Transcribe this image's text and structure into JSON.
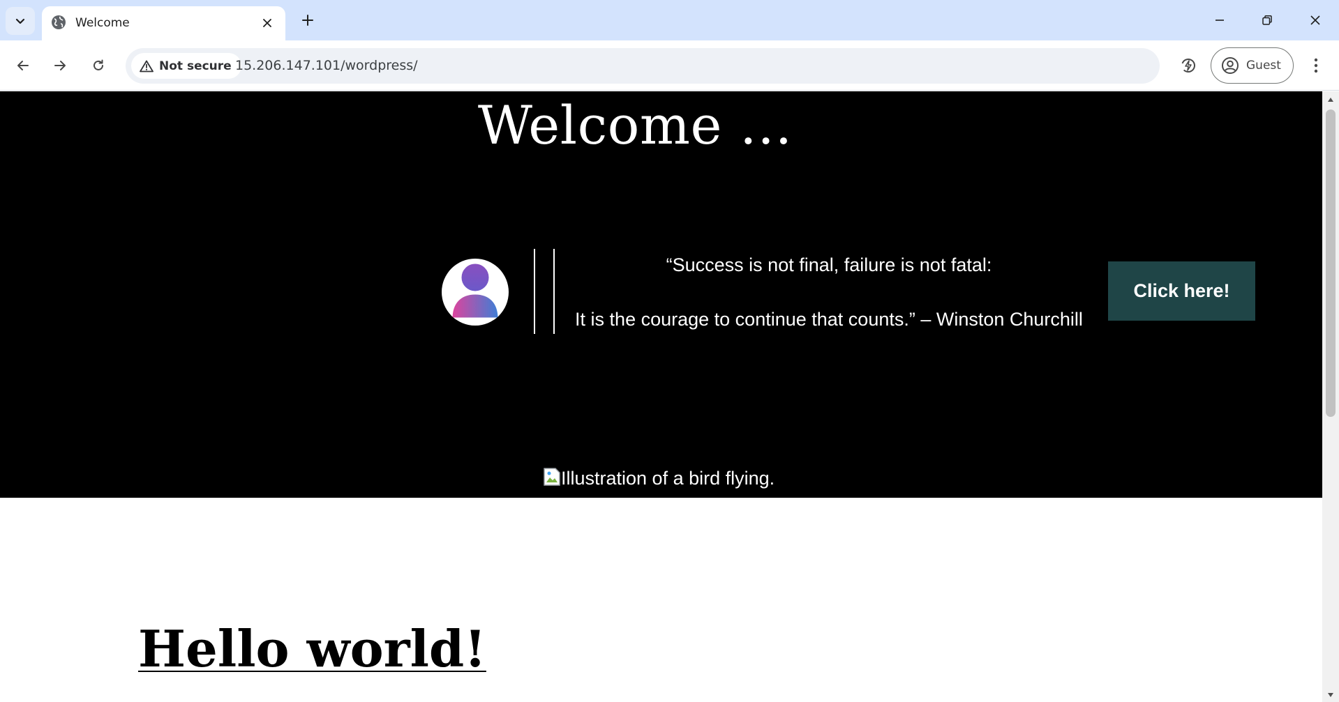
{
  "browser": {
    "tab": {
      "title": "Welcome"
    },
    "address_bar": {
      "security_label": "Not secure",
      "url": "15.206.147.101/wordpress/"
    },
    "profile": {
      "label": "Guest"
    },
    "icons": [
      "tab-search-icon",
      "globe-icon",
      "close-icon",
      "new-tab-icon",
      "minimize-icon",
      "restore-icon",
      "window-close-icon",
      "back-icon",
      "forward-icon",
      "reload-icon",
      "warning-icon",
      "performance-icon",
      "account-icon",
      "menu-icon"
    ]
  },
  "page": {
    "hero": {
      "title": "Welcome …",
      "quote_line1": "“Success is not final, failure is not fatal:",
      "quote_line2": "It is the courage to continue that counts.” – Winston Churchill",
      "button_label": "Click here!",
      "image_alt": "Illustration of a bird flying."
    },
    "post": {
      "title": "Hello world!"
    }
  },
  "colors": {
    "tabstrip_bg": "#d3e3fd",
    "hero_bg": "#000000",
    "button_bg": "#1f4547",
    "avatar_gradient_start": "#e0439c",
    "avatar_gradient_end": "#3c7fd6"
  }
}
